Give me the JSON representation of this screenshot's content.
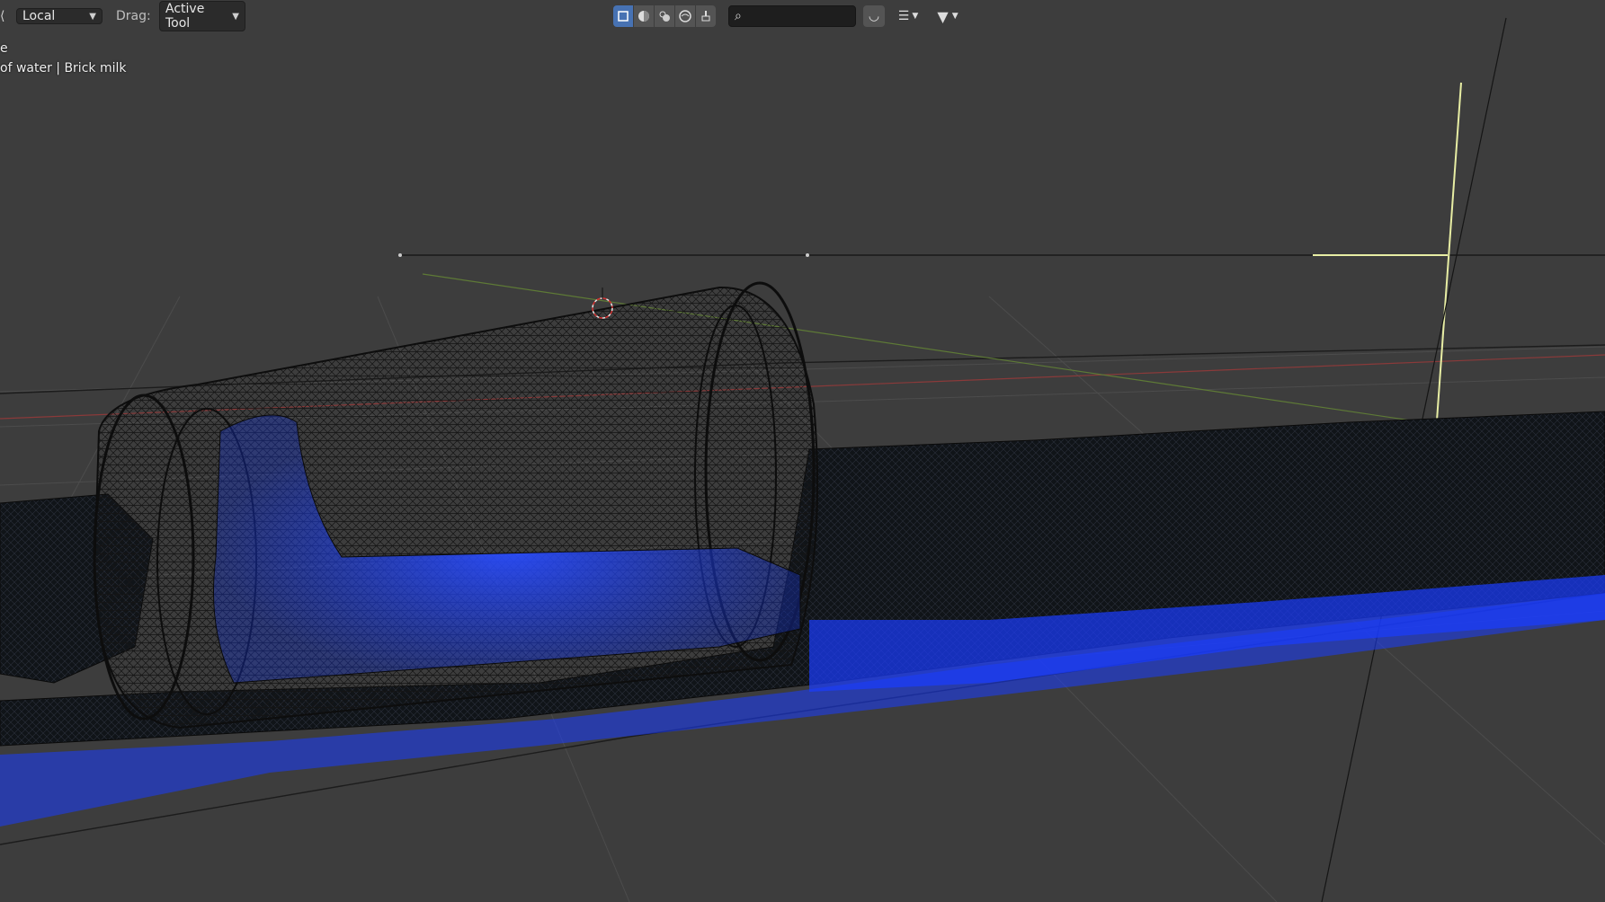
{
  "header": {
    "transform_orientation": "Local",
    "drag_label": "Drag:",
    "drag_value": "Active Tool",
    "search_placeholder": "",
    "shading_modes": [
      "wireframe",
      "solid",
      "material-preview",
      "rendered",
      "retopology"
    ],
    "active_shading": "wireframe"
  },
  "viewport_info": {
    "line1": "e",
    "line2": "of water | Brick milk"
  },
  "colors": {
    "background": "#3d3d3d",
    "grid": "#4a4a4a",
    "x_axis": "#8a3a3a",
    "y_axis": "#5e7a36",
    "wire": "#111111",
    "fluid": "#1a3cff",
    "selected_wire": "#e8eea4",
    "active_button": "#4772b3"
  }
}
